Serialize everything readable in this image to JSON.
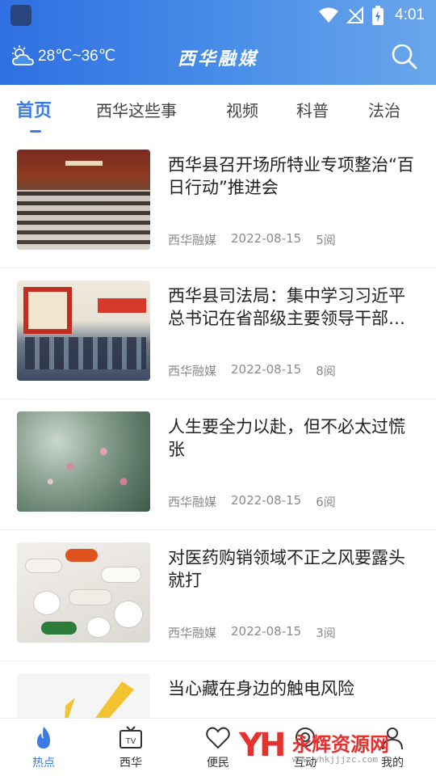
{
  "status_bar": {
    "time": "4:01"
  },
  "header": {
    "weather": "28℃~36℃",
    "title": "西华融媒"
  },
  "tabs": [
    {
      "label": "首页",
      "active": true
    },
    {
      "label": "西华这些事"
    },
    {
      "label": "视频"
    },
    {
      "label": "科普"
    },
    {
      "label": "法治"
    }
  ],
  "articles": [
    {
      "title": "西华县召开场所特业专项整治“百日行动”推进会",
      "source": "西华融媒",
      "date": "2022-08-15",
      "reads": "5阅"
    },
    {
      "title": "西华县司法局：集中学习习近平总书记在省部级主要领导干部专题研讨班上的重要讲话精神",
      "source": "西华融媒",
      "date": "2022-08-15",
      "reads": "8阅"
    },
    {
      "title": "人生要全力以赴，但不必太过慌张",
      "source": "西华融媒",
      "date": "2022-08-15",
      "reads": "6阅"
    },
    {
      "title": "对医药购销领域不正之风要露头就打",
      "source": "西华融媒",
      "date": "2022-08-15",
      "reads": "3阅"
    },
    {
      "title": "当心藏在身边的触电风险",
      "source": "",
      "date": "",
      "reads": ""
    }
  ],
  "bottom_nav": [
    {
      "label": "热点",
      "icon": "flame-icon",
      "active": true
    },
    {
      "label": "西华",
      "icon": "tv-icon"
    },
    {
      "label": "便民",
      "icon": "heart-icon"
    },
    {
      "label": "互动",
      "icon": "chat-icon"
    },
    {
      "label": "我的",
      "icon": "user-icon"
    }
  ],
  "watermark": {
    "logo": "YH",
    "text": "永辉资源网",
    "url": "www.yhkjjjzc.com"
  },
  "colors": {
    "accent": "#3b7be6",
    "header_start": "#2f6fe2",
    "header_end": "#6aa6ea",
    "watermark": "#e6312e"
  }
}
